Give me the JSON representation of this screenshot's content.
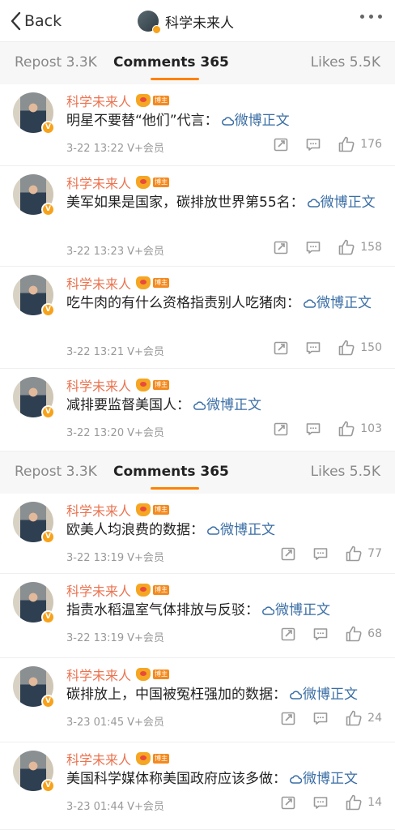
{
  "header": {
    "back_label": "Back",
    "title": "科学未来人"
  },
  "tabs": {
    "repost": "Repost 3.3K",
    "comments": "Comments 365",
    "likes": "Likes 5.5K"
  },
  "comments": [
    {
      "name": "科学未来人",
      "tag": "博主",
      "text": "明星不要替“他们”代言：",
      "link": "微博正文",
      "time": "3-22 13:22",
      "vip": "V+会员",
      "likes": "176"
    },
    {
      "name": "科学未来人",
      "tag": "博主",
      "text": "美军如果是国家，碳排放世界第55名：",
      "link": "微博正文",
      "time": "3-22 13:23",
      "vip": "V+会员",
      "likes": "158"
    },
    {
      "name": "科学未来人",
      "tag": "博主",
      "text": "吃牛肉的有什么资格指责别人吃猪肉：",
      "link": "微博正文",
      "time": "3-22 13:21",
      "vip": "V+会员",
      "likes": "150"
    },
    {
      "name": "科学未来人",
      "tag": "博主",
      "text": "减排要监督美国人：",
      "link": "微博正文",
      "time": "3-22 13:20",
      "vip": "V+会员",
      "likes": "103"
    },
    {
      "name": "科学未来人",
      "tag": "博主",
      "text": "欧美人均浪费的数据：",
      "link": "微博正文",
      "time": "3-22 13:19",
      "vip": "V+会员",
      "likes": "77"
    },
    {
      "name": "科学未来人",
      "tag": "博主",
      "text": "指责水稻温室气体排放与反驳：",
      "link": "微博正文",
      "time": "3-22 13:19",
      "vip": "V+会员",
      "likes": "68"
    },
    {
      "name": "科学未来人",
      "tag": "博主",
      "text": "碳排放上，中国被冤枉强加的数据：",
      "link": "微博正文",
      "time": "3-23 01:45",
      "vip": "V+会员",
      "likes": "24"
    },
    {
      "name": "科学未来人",
      "tag": "博主",
      "text": "美国科学媒体称美国政府应该多做：",
      "link": "微博正文",
      "time": "3-23 01:44",
      "vip": "V+会员",
      "likes": "14"
    }
  ],
  "colors": {
    "accent": "#ff8200",
    "name": "#eb7350",
    "link": "#3a6ea5"
  },
  "icons": {
    "back": "chevron-left-icon",
    "more": "more-dots-icon",
    "link": "link-cloud-icon",
    "repost": "repost-icon",
    "comment": "comment-icon",
    "like": "thumbs-up-icon"
  }
}
